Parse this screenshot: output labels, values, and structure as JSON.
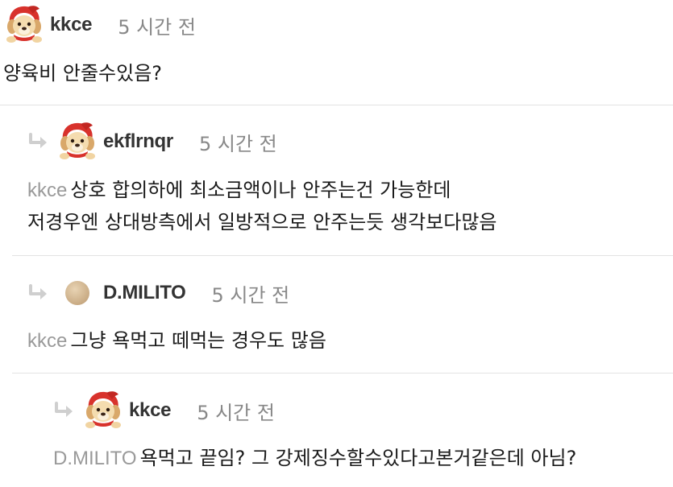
{
  "comments": [
    {
      "username": "kkce",
      "time": "5 시간 전",
      "text": "양육비 안줄수있음?"
    },
    {
      "username": "ekflrnqr",
      "time": "5 시간 전",
      "mention": "kkce",
      "line1": "상호 합의하에 최소금액이나 안주는건 가능한데",
      "line2": "저경우엔 상대방측에서 일방적으로 안주는듯 생각보다많음"
    },
    {
      "username": "D.MILITO",
      "time": "5 시간 전",
      "mention": "kkce",
      "text": "그냥 욕먹고 떼먹는 경우도 많음"
    },
    {
      "username": "kkce",
      "time": "5 시간 전",
      "mention": "D.MILITO",
      "text": "욕먹고 끝임? 그 강제징수할수있다고본거같은데 아님?"
    }
  ],
  "icons": {
    "reply": "reply-arrow-icon",
    "avatar_dog": "dog-red-hood-icon",
    "avatar_plain": "round-avatar-icon"
  },
  "colors": {
    "username": "#333333",
    "time": "#888888",
    "mention": "#9a9a9a",
    "divider": "#e3e3e3",
    "reply_arrow": "#cfcfcf"
  }
}
